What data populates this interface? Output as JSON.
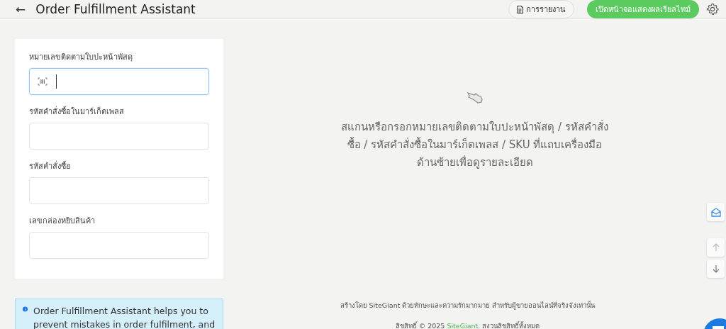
{
  "header": {
    "back": "←",
    "title": "Order Fulfillment Assistant",
    "report_button": "การรายงาน",
    "live_button": "เปิดหน้าจอแสดงผลเรียลไทม์"
  },
  "form": {
    "fields": [
      {
        "label": "หมายเลขติดตามใบปะหน้าพัสดุ",
        "focused": true,
        "kind": "scan"
      },
      {
        "label": "รหัสคำสั่งซื้อในมาร์เก็ตเพลส",
        "focused": false,
        "kind": "text"
      },
      {
        "label": "รหัสคำสั่งซื้อ",
        "focused": false,
        "kind": "text"
      },
      {
        "label": "เลขกล่องหยิบสินค้า",
        "focused": false,
        "kind": "text"
      }
    ]
  },
  "info": {
    "text": "Order Fulfillment Assistant helps you to prevent mistakes in order fulfilment, and"
  },
  "empty_state": {
    "message": "สแกนหรือกรอกหมายเลขติดตามใบปะหน้าพัสดุ / รหัสคำสั่งซื้อ / รหัสคำสั่งซื้อในมาร์เก็ตเพลส / SKU ที่แถบเครื่องมือด้านซ้ายเพื่อดูรายละเอียด"
  },
  "footer": {
    "credit": "สร้างโดย SiteGiant ด้วยทักษะและความรักมากมาย สำหรับผู้ขายออนไลน์ที่จริงจังเท่านั้น",
    "copyright_prefix": "ลิขสิทธิ์ © 2025 ",
    "brand": "SiteGiant",
    "copyright_suffix": ". สงวนลิขสิทธิ์ทั้งหมด"
  }
}
